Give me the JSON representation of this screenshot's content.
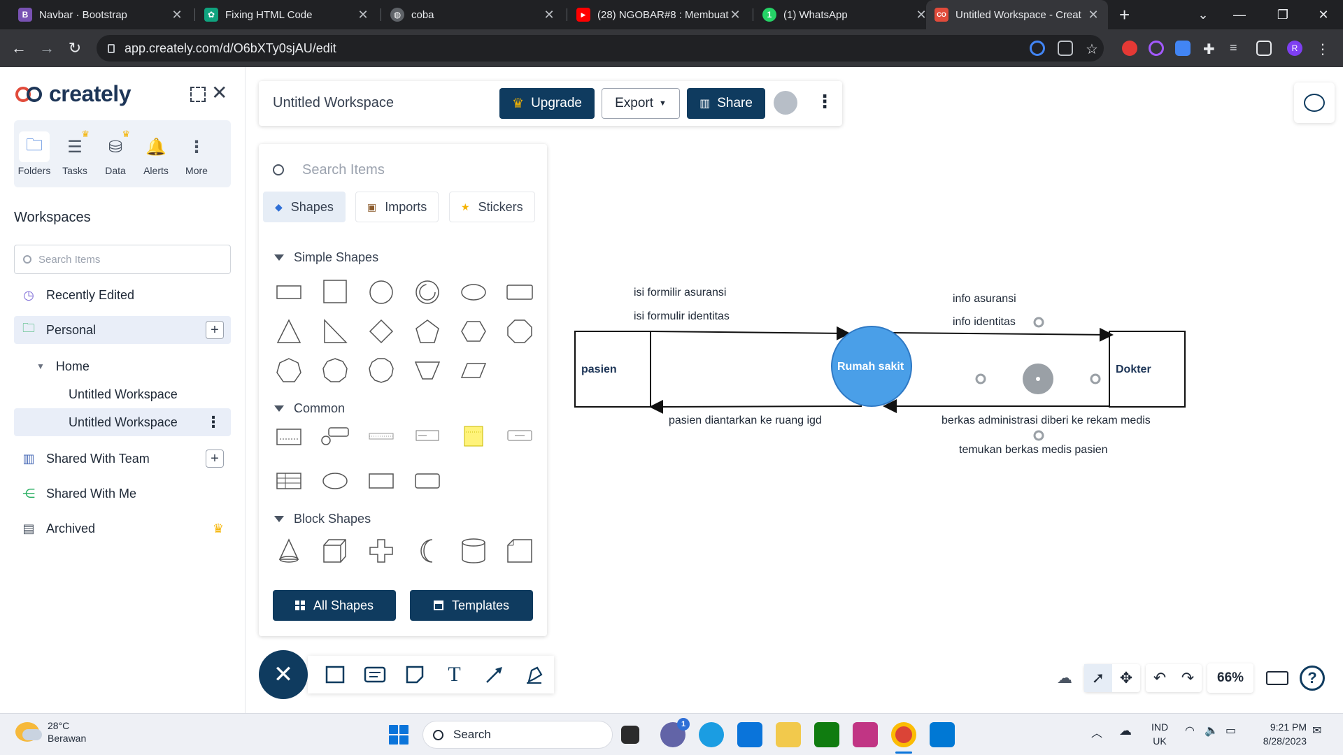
{
  "browser": {
    "tabs": [
      {
        "title": "Navbar · Bootstrap",
        "favicon": "bootstrap-icon",
        "color": "#7952b3",
        "glyph": "B"
      },
      {
        "title": "Fixing HTML Code",
        "favicon": "chatgpt-icon",
        "color": "#10a37f",
        "glyph": "✿"
      },
      {
        "title": "coba",
        "favicon": "globe-icon",
        "color": "#5f6368",
        "glyph": "◍"
      },
      {
        "title": "(28) NGOBAR#8 : Membuat",
        "favicon": "youtube-icon",
        "color": "#ff0000",
        "glyph": "▶"
      },
      {
        "title": "(1) WhatsApp",
        "favicon": "whatsapp-icon",
        "color": "#25d366",
        "glyph": "1"
      },
      {
        "title": "Untitled Workspace - Creat",
        "favicon": "creately-icon",
        "color": "#e14b3b",
        "glyph": "CO"
      }
    ],
    "url": "app.creately.com/d/O6bXTy0sjAU/edit",
    "profile_initial": "R"
  },
  "sidebar": {
    "brand": "creately",
    "rail": [
      {
        "label": "Folders",
        "icon": "folder-icon",
        "glyph": "🗀"
      },
      {
        "label": "Tasks",
        "icon": "tasks-icon",
        "glyph": "☰"
      },
      {
        "label": "Data",
        "icon": "database-icon",
        "glyph": "⛁"
      },
      {
        "label": "Alerts",
        "icon": "bell-icon",
        "glyph": "🔔"
      },
      {
        "label": "More",
        "icon": "more-icon",
        "glyph": "⋮"
      }
    ],
    "workspaces_title": "Workspaces",
    "search_placeholder": "Search Items",
    "items": {
      "recent": "Recently Edited",
      "personal": "Personal",
      "home": "Home",
      "ws1": "Untitled Workspace",
      "ws2": "Untitled Workspace",
      "team": "Shared With Team",
      "me": "Shared With Me",
      "archived": "Archived"
    }
  },
  "topbar": {
    "title": "Untitled Workspace",
    "upgrade": "Upgrade",
    "export": "Export",
    "share": "Share"
  },
  "panel": {
    "search_placeholder": "Search Items",
    "tabs": {
      "shapes": "Shapes",
      "imports": "Imports",
      "stickers": "Stickers"
    },
    "sections": {
      "simple": "Simple Shapes",
      "common": "Common",
      "block": "Block Shapes"
    },
    "all_shapes": "All Shapes",
    "templates": "Templates"
  },
  "diagram": {
    "nodes": {
      "pasien": "pasien",
      "center": "Rumah sakit",
      "dokter": "Dokter"
    },
    "labels": {
      "l1": "isi formilir asuransi",
      "l2": "isi formulir identitas",
      "l3": "info asuransi",
      "l4": "info identitas",
      "l5": "pasien diantarkan ke ruang igd",
      "l6": "berkas administrasi diberi ke rekam medis",
      "l7": "temukan berkas medis pasien"
    },
    "center_color": "#4a9fe8"
  },
  "zoom": "66%",
  "taskbar": {
    "temp": "28°C",
    "weather": "Berawan",
    "search": "Search",
    "lang1": "IND",
    "lang2": "UK",
    "time": "9:21 PM",
    "date": "8/28/2023",
    "teams_badge": "1"
  }
}
